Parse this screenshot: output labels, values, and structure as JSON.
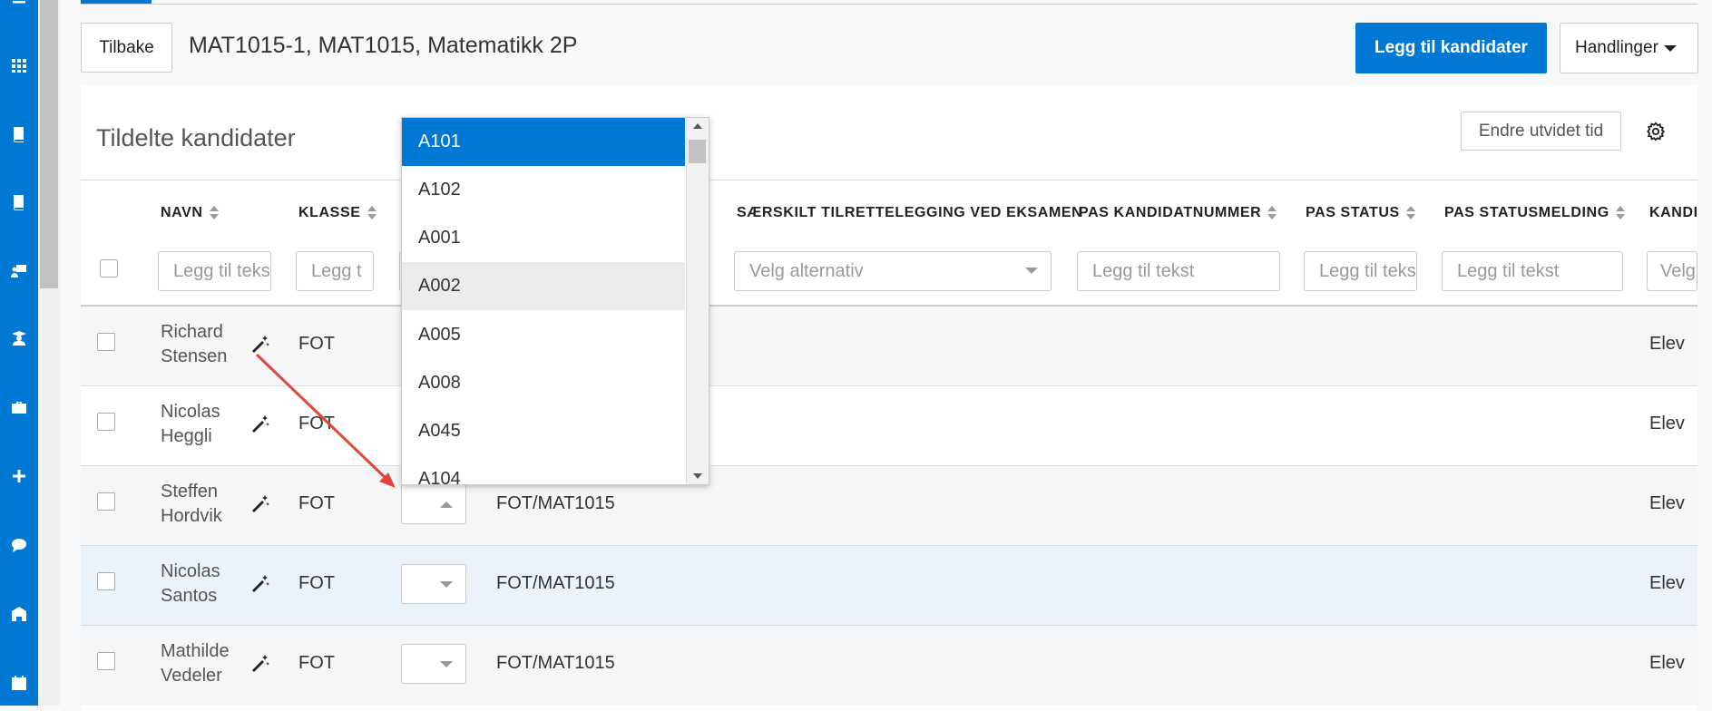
{
  "header": {
    "back_label": "Tilbake",
    "title": "MAT1015-1, MAT1015, Matematikk 2P",
    "add_candidates_label": "Legg til kandidater",
    "actions_label": "Handlinger"
  },
  "card": {
    "title": "Tildelte kandidater",
    "extend_time_label": "Endre utvidet tid"
  },
  "columns": {
    "navn": "NAVN",
    "klasse": "KLASSE",
    "saerskilt": "SÆRSKILT TILRETTELEGGING VED EKSAMEN",
    "pas_kandidatnummer": "PAS KANDIDATNUMMER",
    "pas_status": "PAS STATUS",
    "pas_statusmelding": "PAS STATUSMELDING",
    "kandi": "KANDI"
  },
  "filters": {
    "navn": "Legg til tekst",
    "klasse": "Legg t",
    "saerskilt": "Velg alternativ",
    "pas_kandidatnummer": "Legg til tekst",
    "pas_status": "Legg til tekst",
    "pas_statusmelding": "Legg til tekst",
    "kandi": "Velg"
  },
  "rows": [
    {
      "first": "Richard",
      "last": "Stensen",
      "klasse": "FOT",
      "gruppe": "",
      "type": "Elev"
    },
    {
      "first": "Nicolas",
      "last": "Heggli",
      "klasse": "FOT",
      "gruppe": "",
      "type": "Elev"
    },
    {
      "first": "Steffen",
      "last": "Hordvik",
      "klasse": "FOT",
      "gruppe": "FOT/MAT1015",
      "type": "Elev"
    },
    {
      "first": "Nicolas",
      "last": "Santos",
      "klasse": "FOT",
      "gruppe": "FOT/MAT1015",
      "type": "Elev"
    },
    {
      "first": "Mathilde",
      "last": "Vedeler",
      "klasse": "FOT",
      "gruppe": "FOT/MAT1015",
      "type": "Elev"
    }
  ],
  "dropdown": {
    "options": [
      "A101",
      "A102",
      "A001",
      "A002",
      "A005",
      "A008",
      "A045",
      "A104"
    ],
    "selected": "A101",
    "hovered": "A002"
  },
  "colors": {
    "primary": "#0078d4",
    "selected_row": "#eaf3fc",
    "annotation_arrow": "#e0463b"
  }
}
